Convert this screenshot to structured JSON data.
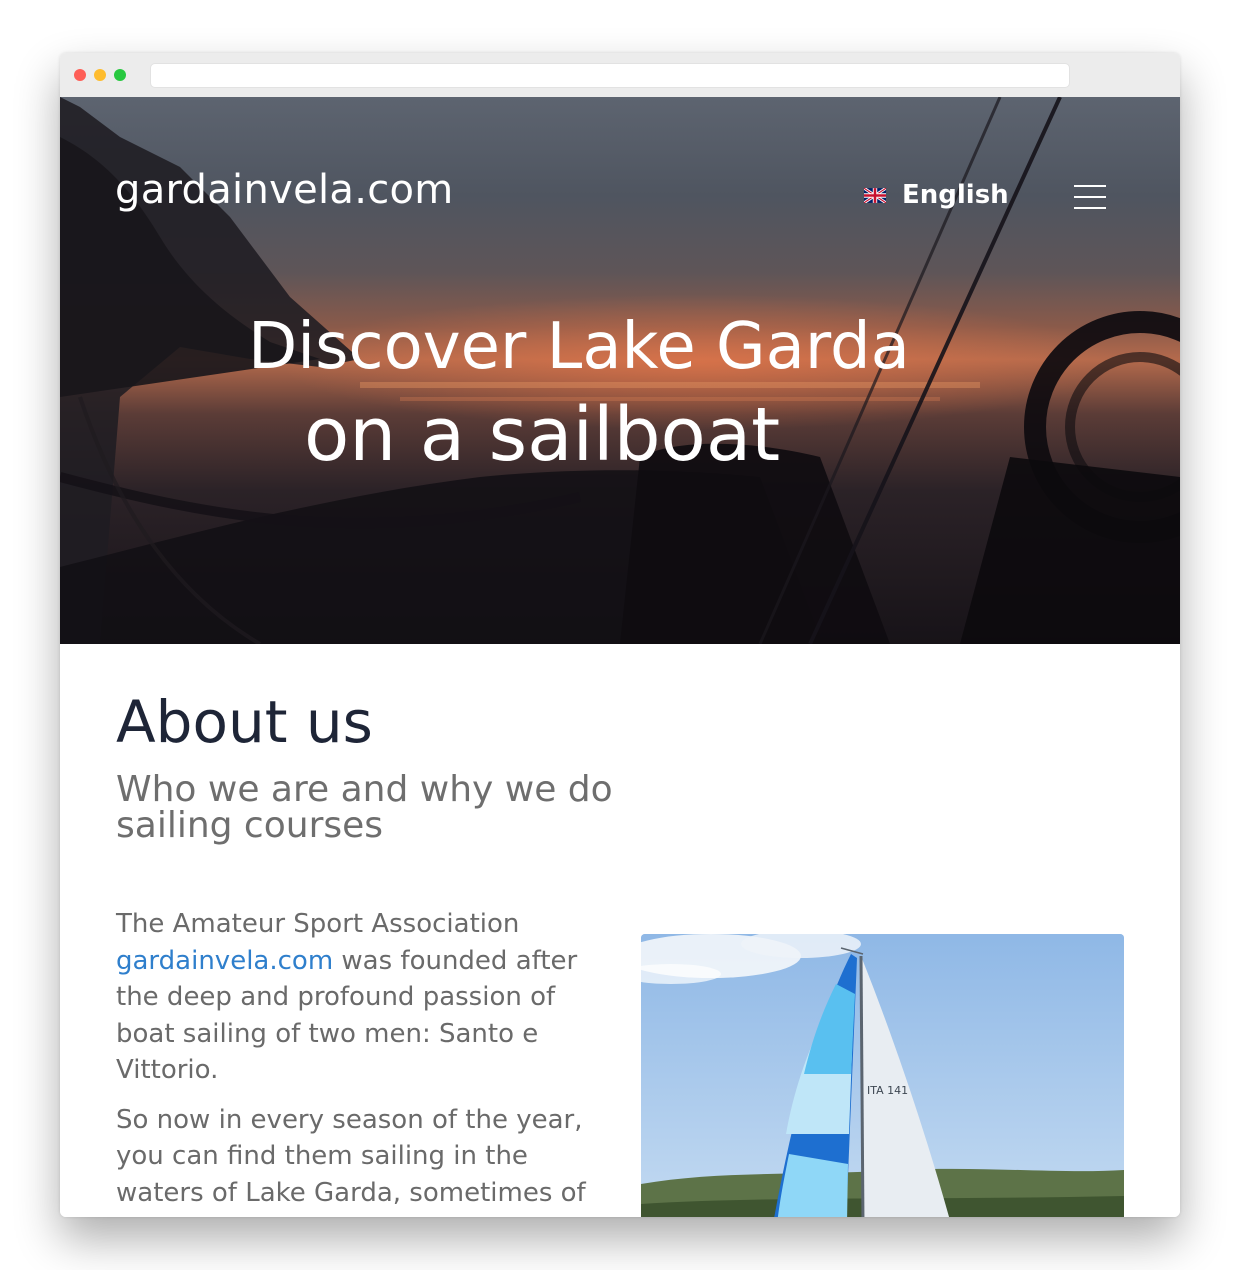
{
  "header": {
    "brand": "gardainvela.com",
    "language": "English",
    "language_icon": "uk-flag-icon",
    "menu_icon": "hamburger-menu-icon"
  },
  "hero": {
    "title_line1": "Discover Lake Garda",
    "title_line2": "on a sailboat"
  },
  "about": {
    "title": "About us",
    "subtitle": "Who we are and why we do sailing courses",
    "paragraph1_before": "The Amateur Sport Association ",
    "paragraph1_link": "gardainvela.com",
    "paragraph1_after": " was founded after the deep and profound passion of boat sailing of two men: Santo e Vittorio.",
    "paragraph2": "So now in every season of the year, you can find them sailing in the waters of Lake Garda, sometimes of",
    "photo_sail_text": "ITA 141"
  },
  "colors": {
    "heading": "#1e2537",
    "subheading": "#6e6e6e",
    "body_text": "#6a6a6a",
    "link": "#2f7fcc"
  }
}
